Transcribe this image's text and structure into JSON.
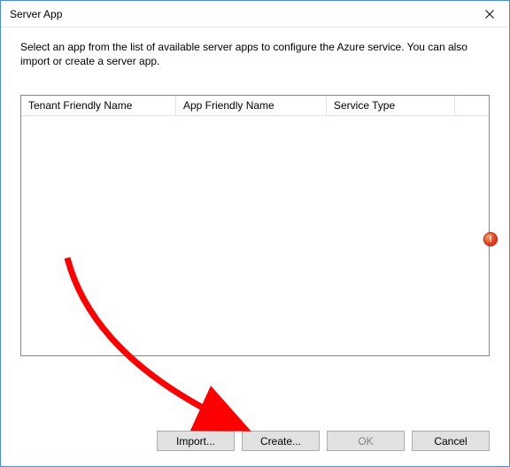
{
  "window": {
    "title": "Server App"
  },
  "instruction": "Select an app from the list of available server apps to configure the Azure service. You can also import or create a server app.",
  "columns": {
    "col0": "Tenant Friendly Name",
    "col1": "App Friendly Name",
    "col2": "Service Type"
  },
  "rows": [],
  "buttons": {
    "import": "Import...",
    "create": "Create...",
    "ok": "OK",
    "cancel": "Cancel"
  },
  "error_badge": "!"
}
